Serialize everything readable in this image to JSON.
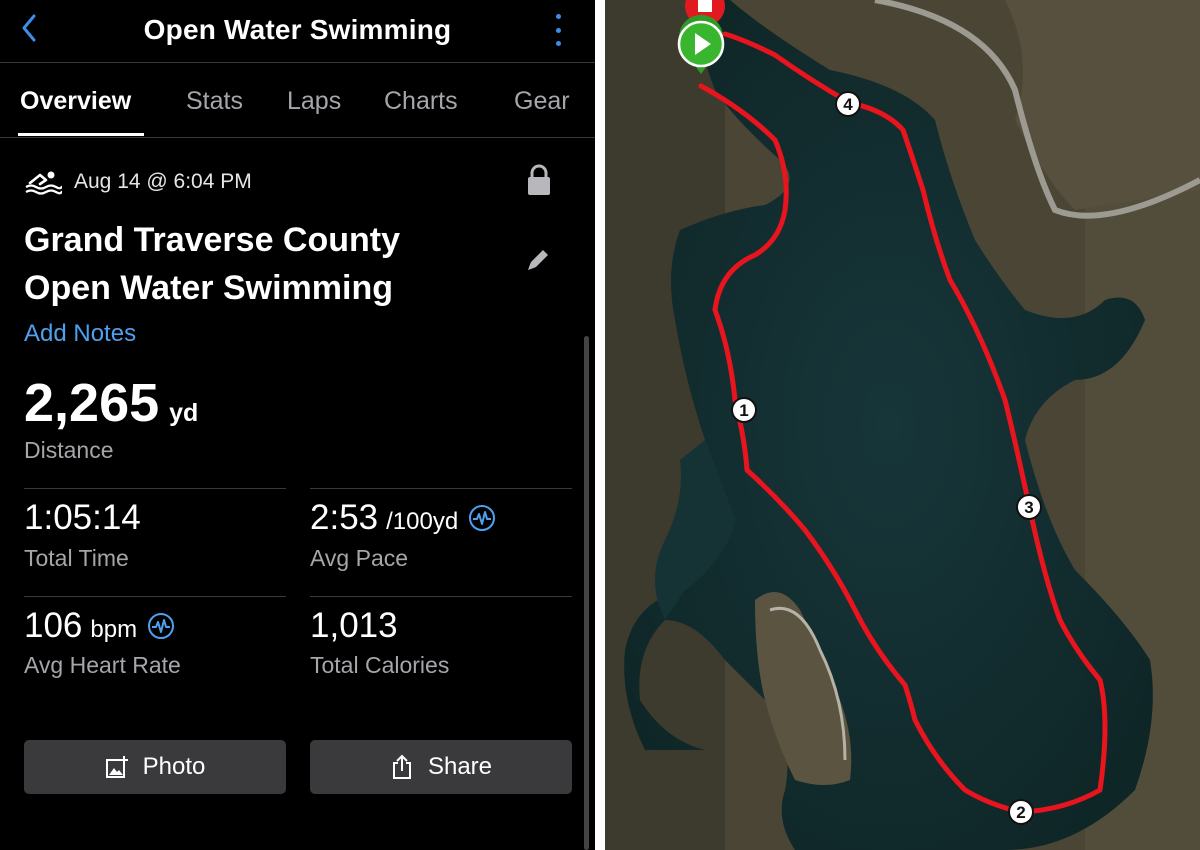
{
  "header": {
    "title": "Open Water Swimming",
    "back_icon": "chevron-left-icon",
    "more_icon": "more-vertical-icon"
  },
  "tabs": [
    {
      "label": "Overview",
      "active": true
    },
    {
      "label": "Stats",
      "active": false
    },
    {
      "label": "Laps",
      "active": false
    },
    {
      "label": "Charts",
      "active": false
    },
    {
      "label": "Gear",
      "active": false
    }
  ],
  "activity": {
    "date": "Aug 14 @ 6:04 PM",
    "title_line1": "Grand Traverse County",
    "title_line2": "Open Water Swimming",
    "add_notes": "Add Notes"
  },
  "distance": {
    "value": "2,265",
    "unit": "yd",
    "label": "Distance"
  },
  "stats": {
    "total_time": {
      "value": "1:05:14",
      "label": "Total Time"
    },
    "avg_pace": {
      "value": "2:53",
      "unit": "/100yd",
      "label": "Avg Pace"
    },
    "avg_hr": {
      "value": "106",
      "unit": "bpm",
      "label": "Avg Heart Rate"
    },
    "total_calories": {
      "value": "1,013",
      "label": "Total Calories"
    }
  },
  "actions": {
    "photo": "Photo",
    "share": "Share"
  },
  "map": {
    "markers": [
      "1",
      "2",
      "3",
      "4"
    ],
    "route_color": "#e8141e",
    "accent_color": "#4ea1f0"
  }
}
